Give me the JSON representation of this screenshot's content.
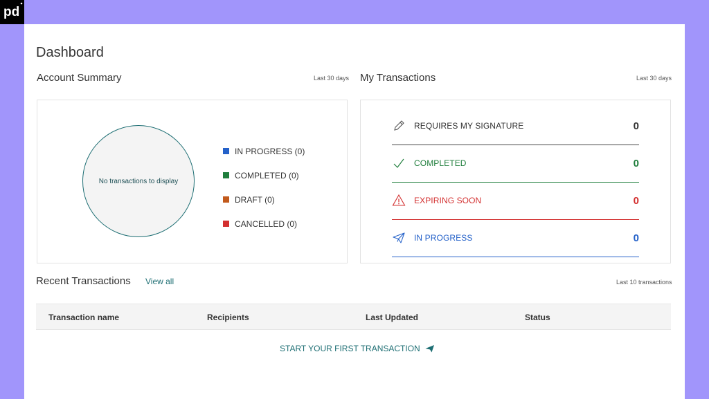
{
  "brand": {
    "logo_text": "pd"
  },
  "page": {
    "title": "Dashboard"
  },
  "account_summary": {
    "title": "Account Summary",
    "period": "Last 30 days",
    "empty_text": "No transactions to display",
    "legend": [
      {
        "label": "IN PROGRESS (0)",
        "color": "#2461c9"
      },
      {
        "label": "COMPLETED (0)",
        "color": "#1f7e3c"
      },
      {
        "label": "DRAFT (0)",
        "color": "#c25a1c"
      },
      {
        "label": "CANCELLED (0)",
        "color": "#d32f2f"
      }
    ]
  },
  "my_transactions": {
    "title": "My Transactions",
    "period": "Last 30 days",
    "rows": [
      {
        "label": "REQUIRES MY SIGNATURE",
        "count": "0",
        "color": "#333333",
        "line_color": "#444444",
        "icon": "pencil-icon"
      },
      {
        "label": "COMPLETED",
        "count": "0",
        "color": "#1f7e3c",
        "line_color": "#1f7e3c",
        "icon": "checkmark-icon"
      },
      {
        "label": "EXPIRING SOON",
        "count": "0",
        "color": "#d32f2f",
        "line_color": "#d32f2f",
        "icon": "warning-icon"
      },
      {
        "label": "IN PROGRESS",
        "count": "0",
        "color": "#2461c9",
        "line_color": "#2461c9",
        "icon": "paper-plane-icon"
      }
    ]
  },
  "recent_transactions": {
    "title": "Recent Transactions",
    "view_all": "View all",
    "period": "Last 10 transactions",
    "columns": [
      "Transaction name",
      "Recipients",
      "Last Updated",
      "Status"
    ],
    "start_label": "START YOUR FIRST TRANSACTION"
  }
}
